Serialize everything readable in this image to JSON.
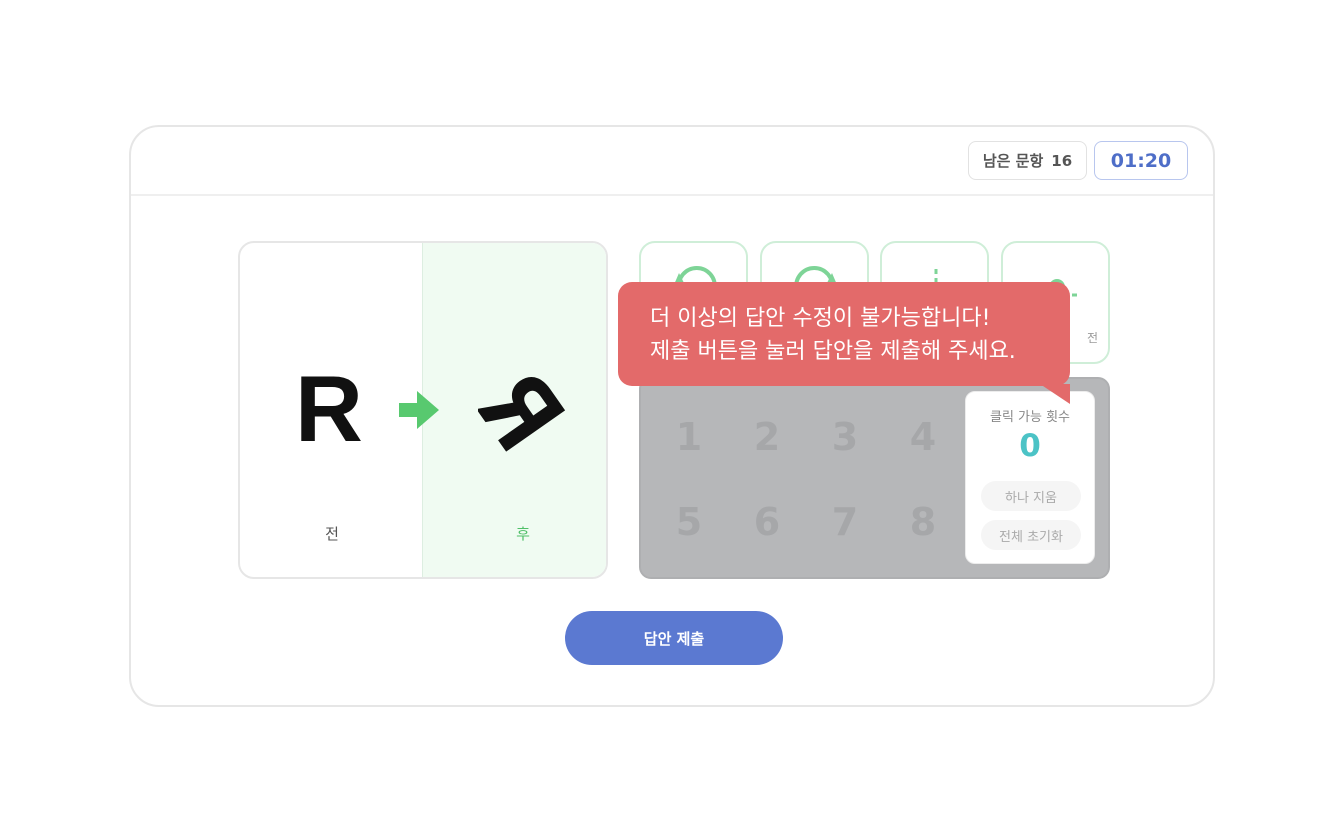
{
  "header": {
    "remaining_label": "남은 문항",
    "remaining_count": "16",
    "timer": "01:20"
  },
  "comparison": {
    "before_glyph": "R",
    "before_label": "전",
    "after_label": "후",
    "arrow_icon": "right-arrow-icon",
    "after_icon": "transformed-r-glyph-icon"
  },
  "tools": [
    {
      "icon": "rotate-left-icon",
      "label": ""
    },
    {
      "icon": "rotate-right-icon",
      "label": ""
    },
    {
      "icon": "flip-horizontal-icon",
      "label": ""
    },
    {
      "icon": "flip-vertical-icon",
      "label": "전"
    }
  ],
  "keypad": {
    "keys": [
      "1",
      "2",
      "3",
      "4",
      "5",
      "6",
      "7",
      "8"
    ],
    "click_panel": {
      "title": "클릭 가능 횟수",
      "count": "0",
      "delete_one": "하나 지움",
      "reset_all": "전체 초기화"
    }
  },
  "submit_label": "답안 제출",
  "toast": {
    "line1": "더 이상의 답안 수정이 불가능합니다!",
    "line2": "제출 버튼을 눌러 답안을 제출해 주세요."
  },
  "colors": {
    "accent_blue": "#5b79d1",
    "accent_green": "#58c96f",
    "toast_red": "#e36a6a",
    "count_teal": "#4cc3c6"
  }
}
